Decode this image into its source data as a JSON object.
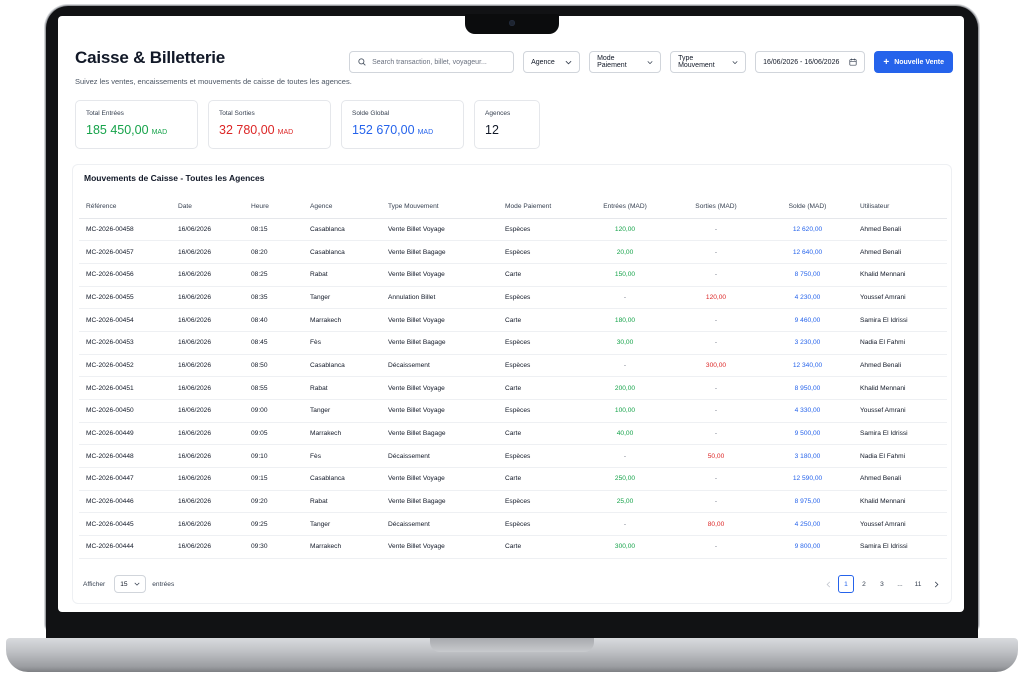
{
  "header": {
    "title": "Caisse & Billetterie",
    "subtitle": "Suivez les ventes, encaissements et mouvements de caisse de toutes les agences."
  },
  "toolbar": {
    "search_placeholder": "Search transaction, billet, voyageur...",
    "filter_agence": "Agence",
    "filter_mode": "Mode Paiement",
    "filter_type": "Type Mouvement",
    "date_range": "16/06/2026 - 16/06/2026",
    "new_sale": "Nouvelle Vente"
  },
  "cards": [
    {
      "label": "Total Entrées",
      "value": "185 450,00",
      "unit": "MAD",
      "color": "#16a34a"
    },
    {
      "label": "Total Sorties",
      "value": "32 780,00",
      "unit": "MAD",
      "color": "#dc2626"
    },
    {
      "label": "Solde Global",
      "value": "152 670,00",
      "unit": "MAD",
      "color": "#2563eb"
    },
    {
      "label": "Agences",
      "value": "12",
      "unit": "",
      "color": "#111827"
    }
  ],
  "table": {
    "title": "Mouvements de Caisse - Toutes les Agences",
    "columns": [
      "Référence",
      "Date",
      "Heure",
      "Agence",
      "Type Mouvement",
      "Mode Paiement",
      "Entrées (MAD)",
      "Sorties (MAD)",
      "Solde (MAD)",
      "Utilisateur"
    ],
    "rows": [
      [
        "MC-2026-00458",
        "16/06/2026",
        "08:15",
        "Casablanca",
        "Vente Billet Voyage",
        "Espèces",
        "120,00",
        "-",
        "12 620,00",
        "Ahmed Benali"
      ],
      [
        "MC-2026-00457",
        "16/06/2026",
        "08:20",
        "Casablanca",
        "Vente Billet Bagage",
        "Espèces",
        "20,00",
        "-",
        "12 640,00",
        "Ahmed Benali"
      ],
      [
        "MC-2026-00456",
        "16/06/2026",
        "08:25",
        "Rabat",
        "Vente Billet Voyage",
        "Carte",
        "150,00",
        "-",
        "8 750,00",
        "Khalid Mennani"
      ],
      [
        "MC-2026-00455",
        "16/06/2026",
        "08:35",
        "Tanger",
        "Annulation Billet",
        "Espèces",
        "-",
        "120,00",
        "4 230,00",
        "Youssef Amrani"
      ],
      [
        "MC-2026-00454",
        "16/06/2026",
        "08:40",
        "Marrakech",
        "Vente Billet Voyage",
        "Carte",
        "180,00",
        "-",
        "9 460,00",
        "Samira El Idrissi"
      ],
      [
        "MC-2026-00453",
        "16/06/2026",
        "08:45",
        "Fès",
        "Vente Billet Bagage",
        "Espèces",
        "30,00",
        "-",
        "3 230,00",
        "Nadia El Fahmi"
      ],
      [
        "MC-2026-00452",
        "16/06/2026",
        "08:50",
        "Casablanca",
        "Décaissement",
        "Espèces",
        "-",
        "300,00",
        "12 340,00",
        "Ahmed Benali"
      ],
      [
        "MC-2026-00451",
        "16/06/2026",
        "08:55",
        "Rabat",
        "Vente Billet Voyage",
        "Carte",
        "200,00",
        "-",
        "8 950,00",
        "Khalid Mennani"
      ],
      [
        "MC-2026-00450",
        "16/06/2026",
        "09:00",
        "Tanger",
        "Vente Billet Voyage",
        "Espèces",
        "100,00",
        "-",
        "4 330,00",
        "Youssef Amrani"
      ],
      [
        "MC-2026-00449",
        "16/06/2026",
        "09:05",
        "Marrakech",
        "Vente Billet Bagage",
        "Carte",
        "40,00",
        "-",
        "9 500,00",
        "Samira El Idrissi"
      ],
      [
        "MC-2026-00448",
        "16/06/2026",
        "09:10",
        "Fès",
        "Décaissement",
        "Espèces",
        "-",
        "50,00",
        "3 180,00",
        "Nadia El Fahmi"
      ],
      [
        "MC-2026-00447",
        "16/06/2026",
        "09:15",
        "Casablanca",
        "Vente Billet Voyage",
        "Carte",
        "250,00",
        "-",
        "12 590,00",
        "Ahmed Benali"
      ],
      [
        "MC-2026-00446",
        "16/06/2026",
        "09:20",
        "Rabat",
        "Vente Billet Bagage",
        "Espèces",
        "25,00",
        "-",
        "8 975,00",
        "Khalid Mennani"
      ],
      [
        "MC-2026-00445",
        "16/06/2026",
        "09:25",
        "Tanger",
        "Décaissement",
        "Espèces",
        "-",
        "80,00",
        "4 250,00",
        "Youssef Amrani"
      ],
      [
        "MC-2026-00444",
        "16/06/2026",
        "09:30",
        "Marrakech",
        "Vente Billet Voyage",
        "Carte",
        "300,00",
        "-",
        "9 800,00",
        "Samira El Idrissi"
      ]
    ]
  },
  "footer": {
    "show_label": "Afficher",
    "per_page": "15",
    "entries_label": "entrées",
    "pages": [
      "1",
      "2",
      "3",
      "...",
      "11"
    ],
    "current_page": "1"
  },
  "icons": {
    "search": "search-icon",
    "calendar": "calendar-icon",
    "chevron": "chevron-down-icon",
    "prev": "chevron-left-icon",
    "next": "chevron-right-icon",
    "plus": "plus-icon"
  },
  "colors": {
    "accent": "#2563eb",
    "positive": "#16a34a",
    "negative": "#dc2626"
  }
}
